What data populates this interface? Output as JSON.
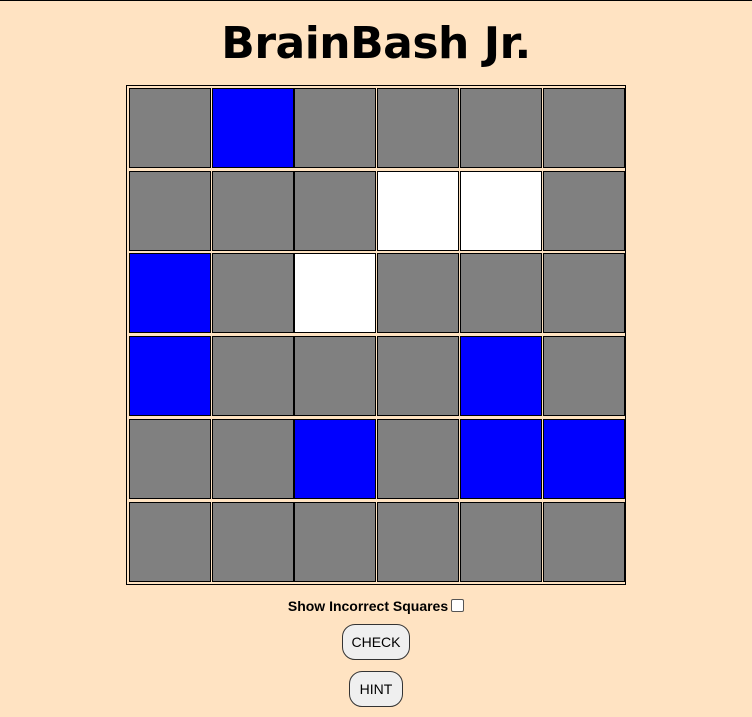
{
  "title": "BrainBash Jr.",
  "board": {
    "rows": 6,
    "cols": 6,
    "colors": {
      "gray": "#808080",
      "blue": "#0000ff",
      "white": "#ffffff"
    },
    "cells": [
      [
        "gray",
        "blue",
        "gray",
        "gray",
        "gray",
        "gray"
      ],
      [
        "gray",
        "gray",
        "gray",
        "white",
        "white",
        "gray"
      ],
      [
        "blue",
        "gray",
        "white",
        "gray",
        "gray",
        "gray"
      ],
      [
        "blue",
        "gray",
        "gray",
        "gray",
        "blue",
        "gray"
      ],
      [
        "gray",
        "gray",
        "blue",
        "gray",
        "blue",
        "blue"
      ],
      [
        "gray",
        "gray",
        "gray",
        "gray",
        "gray",
        "gray"
      ]
    ]
  },
  "controls": {
    "show_incorrect_label": "Show Incorrect Squares",
    "show_incorrect_checked": false,
    "check_label": "CHECK",
    "hint_label": "HINT"
  }
}
